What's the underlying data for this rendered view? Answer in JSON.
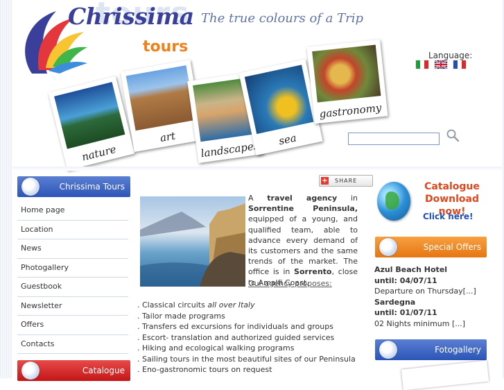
{
  "brand": {
    "name": "Chrissima",
    "sub": "tours",
    "bg_word": "tours",
    "tagline": "The true colours of a Trip"
  },
  "polaroids": [
    {
      "caption": "nature"
    },
    {
      "caption": "art"
    },
    {
      "caption": "landscapes"
    },
    {
      "caption": "sea"
    },
    {
      "caption": "gastronomy"
    }
  ],
  "language": {
    "label": "Language:",
    "flags": [
      "flag-italian",
      "flag-english",
      "flag-french"
    ]
  },
  "search": {
    "placeholder": ""
  },
  "sidebar": {
    "title": "Chrissima Tours",
    "items": [
      {
        "label": "Home page"
      },
      {
        "label": "Location"
      },
      {
        "label": "News"
      },
      {
        "label": "Photogallery"
      },
      {
        "label": "Guestbook"
      },
      {
        "label": "Newsletter"
      },
      {
        "label": "Offers"
      },
      {
        "label": "Contacts"
      }
    ],
    "catalogue_title": "Catalogue"
  },
  "share": {
    "label": "SHARE"
  },
  "intro": {
    "p1": "A ",
    "b1": "travel agency",
    "p2": " in ",
    "b2": "Sorrentine Peninsula,",
    "p3": " equipped of a young, and qualified team, able to advance every demand of its customers and the same trends of the market. The office is in ",
    "b3": "Sorrento",
    "p4": ", close to Amalfi Coast."
  },
  "proposes": "Our agency proposes:",
  "services": {
    "s1a": ". Classical circuits ",
    "s1b": "all over Italy",
    "s2": ". Tailor made programs",
    "s3": ". Transfers ed excursions for individuals and groups",
    "s4": ". Escort- translation and authorized guided services",
    "s5": ". Hiking and ecological walking programs",
    "s6": ". Sailing tours in the most beautiful sites of our Peninsula",
    "s7": ". Eno-gastronomic tours on request"
  },
  "catalogue_promo": {
    "line1": "Catalogue",
    "line2": "Download now!",
    "link": "Click here!"
  },
  "special_offers": {
    "title": "Special Offers",
    "items": [
      {
        "name": "Azul Beach Hotel",
        "until": "until: 04/07/11",
        "desc": "Departure on Thursday[...]"
      },
      {
        "name": "Sardegna",
        "until": "until: 01/07/11",
        "desc": "02 Nights minimum [...]"
      }
    ]
  },
  "fotogallery": {
    "title": "Fotogallery"
  }
}
